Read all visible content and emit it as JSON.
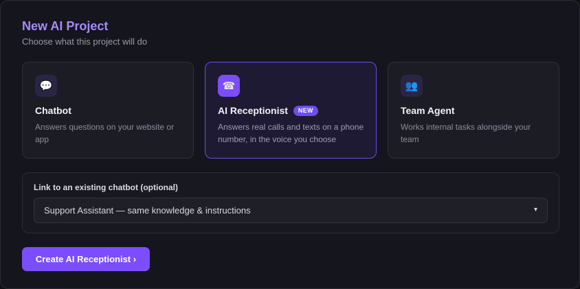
{
  "header": {
    "title": "New AI Project",
    "subtitle": "Choose what this project will do"
  },
  "cards": [
    {
      "icon": "speech-bubble-icon",
      "glyph": "💬",
      "title": "Chatbot",
      "description": "Answers questions on your website or app",
      "selected": false
    },
    {
      "icon": "telephone-icon",
      "glyph": "☎",
      "title": "AI Receptionist",
      "badge": "NEW",
      "description": "Answers real calls and texts on a phone number, in the voice you choose",
      "selected": true
    },
    {
      "icon": "people-icon",
      "glyph": "👥",
      "title": "Team Agent",
      "description": "Works internal tasks alongside your team",
      "selected": false
    }
  ],
  "link": {
    "label": "Link to an existing chatbot (optional)",
    "selected_value": "Support Assistant — same knowledge & instructions",
    "chevron": "▾"
  },
  "actions": {
    "create_label": "Create AI Receptionist ›"
  },
  "colors": {
    "accent": "#7c4dff",
    "title": "#a78bfa",
    "background": "#15151d"
  }
}
